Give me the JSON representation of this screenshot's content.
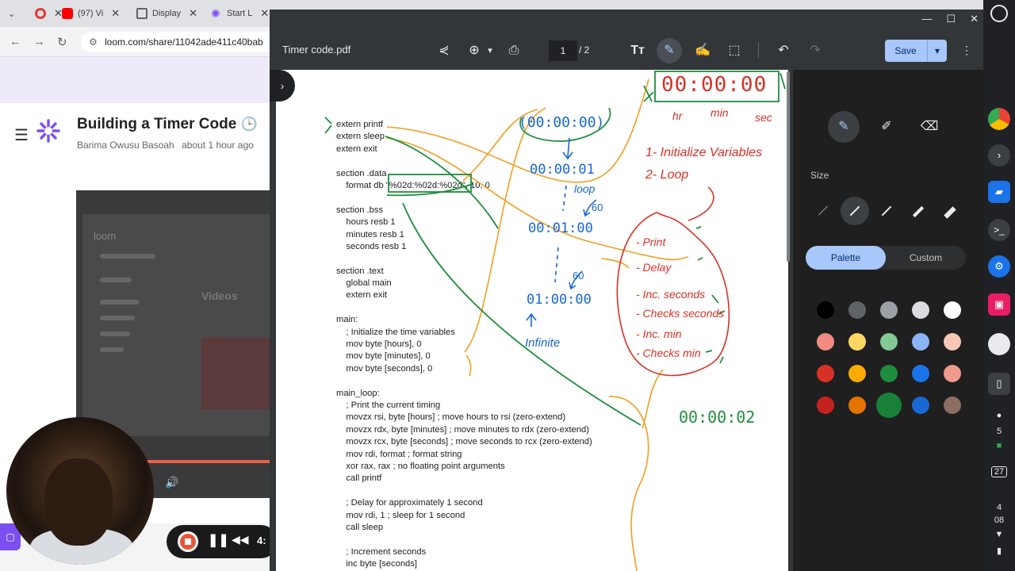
{
  "browser": {
    "tabs": [
      {
        "title": "",
        "color": "#e53935"
      },
      {
        "title": "(97) Vi",
        "color": "#ff0000"
      },
      {
        "title": "Display",
        "color": "#5f6368"
      },
      {
        "title": "Start L",
        "color": "#7b4ff0"
      }
    ],
    "url": "loom.com/share/11042ade411c40bab"
  },
  "loom": {
    "title": "Building a Timer Code",
    "title_emoji": "🕒",
    "author": "Barima Owusu Basoah",
    "time_ago": "about 1 hour ago",
    "video_brand": "loom",
    "video_section": "Videos",
    "record_time": "4:"
  },
  "viewer": {
    "doc_title": "Timer code.pdf",
    "page_current": "1",
    "page_total": "/   2",
    "save_label": "Save",
    "code_lines": [
      "extern printf",
      "extern sleep",
      "extern exit",
      "",
      "section .data",
      "    format db \"%02d:%02d:%02d\", 10, 0",
      "",
      "section .bss",
      "    hours resb 1",
      "    minutes resb 1",
      "    seconds resb 1",
      "",
      "section .text",
      "    global main",
      "    extern exit",
      "",
      "main:",
      "    ; Initialize the time variables",
      "    mov byte [hours], 0",
      "    mov byte [minutes], 0",
      "    mov byte [seconds], 0",
      "",
      "main_loop:",
      "    ; Print the current timing",
      "    movzx rsi, byte [hours] ; move hours to rsi (zero-extend)",
      "    movzx rdx, byte [minutes] ; move minutes to rdx (zero-extend)",
      "    movzx rcx, byte [seconds] ; move seconds to rcx (zero-extend)",
      "    mov rdi, format ; format string",
      "    xor rax, rax ; no floating point arguments",
      "    call printf",
      "",
      "    ; Delay for approximately 1 second",
      "    mov rdi, 1 ; sleep for 1 second",
      "    call sleep",
      "",
      "    ; Increment seconds",
      "    inc byte [seconds]"
    ],
    "handwriting": {
      "top_timer": "00:00:00",
      "hr": "hr",
      "min": "min",
      "sec": "sec",
      "step1": "1- Initialize Variables",
      "step2": "2- Loop",
      "loop_items": [
        "- Print",
        "- Delay",
        "- Inc. seconds",
        "- Checks seconds",
        "- Inc. min",
        "- Checks min"
      ],
      "t0": "(00:00:00)",
      "t1": "00:00:01",
      "loop": "loop",
      "sixty_a": "60",
      "t2": "00:01:00",
      "sixty_b": "60",
      "t3": "01:00:00",
      "infinite": "Infinite",
      "t4": "00:00:02"
    }
  },
  "panel": {
    "size_label": "Size",
    "tab_palette": "Palette",
    "tab_custom": "Custom",
    "palette_colors": [
      "#000000",
      "#5f6368",
      "#9aa0a6",
      "#dadce0",
      "#ffffff",
      "#f28b82",
      "#fdd663",
      "#81c995",
      "#8ab4f8",
      "#f6c7b6",
      "#d93025",
      "#f9ab00",
      "#1e8e3e",
      "#1a73e8",
      "#ee9a8c",
      "#c5221f",
      "#e37400",
      "#188038",
      "#1967d2",
      "#8d6e63"
    ]
  },
  "shelf": {
    "notif_count": "5",
    "date": "27",
    "time_hour": "4",
    "time_min": "08"
  }
}
